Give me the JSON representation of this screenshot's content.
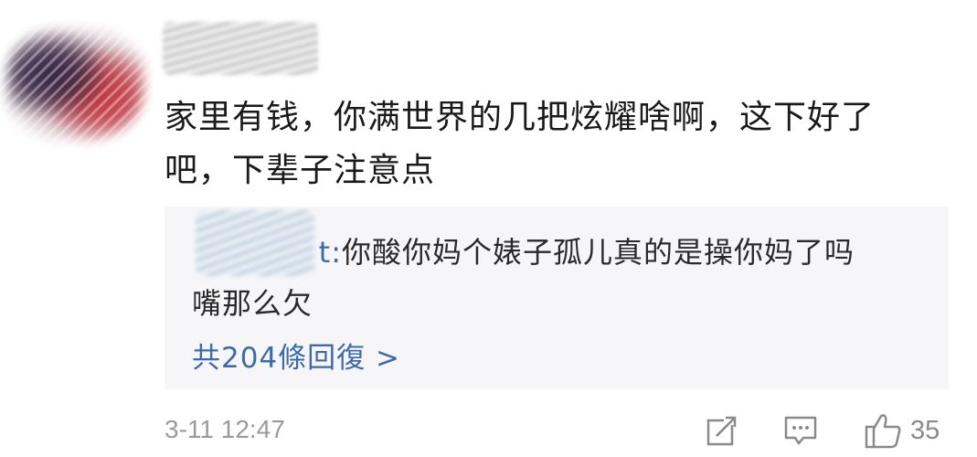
{
  "comment": {
    "text_line1": "家里有钱，你满世界的几把炫耀啥啊，这下好了",
    "text_line2": "吧，下辈子注意点"
  },
  "reply": {
    "prefix": "t: ",
    "text_line1": "你酸你妈个婊子孤儿真的是操你妈了吗",
    "text_line2": "嘴那么欠",
    "more_label": "共204條回復 >"
  },
  "footer": {
    "timestamp": "3-11 12:47",
    "like_count": "35",
    "icons": [
      "share-icon",
      "comment-icon",
      "thumbs-up-icon"
    ]
  },
  "colors": {
    "link": "#3d6aa8",
    "text": "#1a1a1a",
    "muted": "#9a9a9a",
    "reply_bg": "#f6f6f8"
  }
}
